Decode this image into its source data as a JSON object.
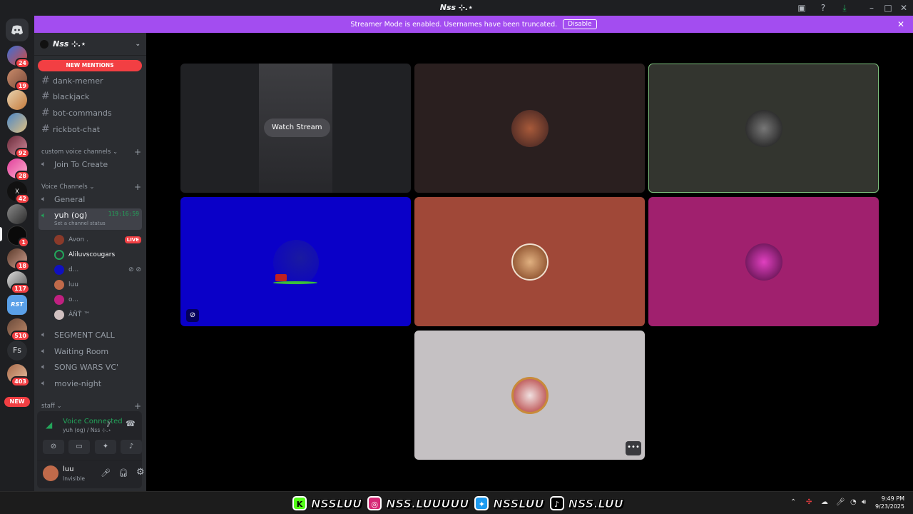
{
  "window": {
    "title": "Nss ⊹.⋆"
  },
  "banner": {
    "text": "Streamer Mode is enabled. Usernames have been truncated.",
    "button": "Disable"
  },
  "rail": {
    "badges": [
      "24",
      "19",
      "92",
      "28",
      "42",
      "1",
      "18",
      "117",
      "510",
      "403"
    ],
    "server_text": "Fs",
    "new_label": "NEW"
  },
  "sidebar": {
    "guild_name": "Nss ⊹.⋆",
    "new_mentions": "NEW MENTIONS",
    "text_channels": [
      "dank-memer",
      "blackjack",
      "bot-commands",
      "rickbot-chat"
    ],
    "categories": {
      "custom": "custom voice channels",
      "voice": "Voice Channels",
      "staff": "staff"
    },
    "custom_channels": [
      "Join To Create"
    ],
    "voice_general": "General",
    "active_channel": {
      "name": "yuh (og)",
      "timer": "119:16:59",
      "status": "Set a channel status"
    },
    "voice_users": [
      {
        "name": "Avon .",
        "live": "LIVE"
      },
      {
        "name": "Aliluvscougars"
      },
      {
        "name": "d..."
      },
      {
        "name": "luu"
      },
      {
        "name": "o..."
      },
      {
        "name": "ÂÑŤ ™"
      }
    ],
    "more_voice": [
      "SEGMENT CALL",
      "Waiting Room",
      "SONG WARS VC'",
      "movie-night"
    ]
  },
  "voice_panel": {
    "title": "Voice Connected",
    "subtitle": "yuh (og) / Nss ⊹.⋆",
    "user": {
      "name": "luu",
      "status": "Invisible"
    }
  },
  "stage": {
    "watch_label": "Watch Stream"
  },
  "taskbar": {
    "handles": [
      "NSSLUU",
      "NSS.LUUUUU",
      "NSSLUU",
      "NSS.LUU"
    ],
    "time": "9:49 PM",
    "date": "9/23/2025"
  },
  "colors": {
    "accent_banner": "#a34df0",
    "danger": "#f23f43",
    "connected": "#23a55a"
  }
}
